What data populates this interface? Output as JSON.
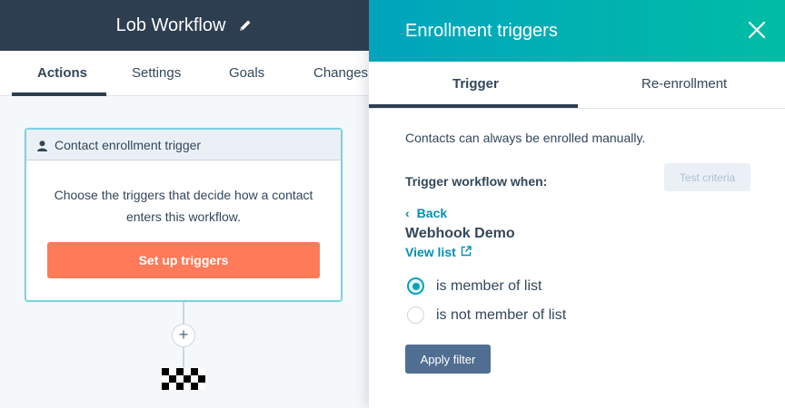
{
  "workflow": {
    "title": "Lob Workflow",
    "tabs": [
      "Actions",
      "Settings",
      "Goals",
      "Changes"
    ],
    "active_tab": "Actions",
    "trigger_card": {
      "header": "Contact enrollment trigger",
      "description": "Choose the triggers that decide how a contact enters this workflow.",
      "button_label": "Set up triggers"
    },
    "add_action_symbol": "+"
  },
  "panel": {
    "title": "Enrollment triggers",
    "tabs": [
      "Trigger",
      "Re-enrollment"
    ],
    "active_tab": "Trigger",
    "note": "Contacts can always be enrolled manually.",
    "trigger_when_label": "Trigger workflow when:",
    "test_button_label": "Test criteria",
    "back_label": "Back",
    "back_symbol": "‹",
    "list_name": "Webhook Demo",
    "view_list_label": "View list",
    "options": [
      {
        "label": "is member of list",
        "selected": true
      },
      {
        "label": "is not member of list",
        "selected": false
      }
    ],
    "apply_button_label": "Apply filter"
  },
  "colors": {
    "nav_dark": "#2d3e50",
    "teal_start": "#00a4bd",
    "teal_end": "#00bda5",
    "orange": "#ff7a59",
    "link": "#0091ae",
    "apply_button": "#506e91"
  },
  "icons": {
    "title_edit": "pencil-icon",
    "card_header": "person-icon",
    "panel_close": "close-icon",
    "view_list_external": "external-link-icon",
    "end_of_workflow": "checkered-flag-icon"
  }
}
